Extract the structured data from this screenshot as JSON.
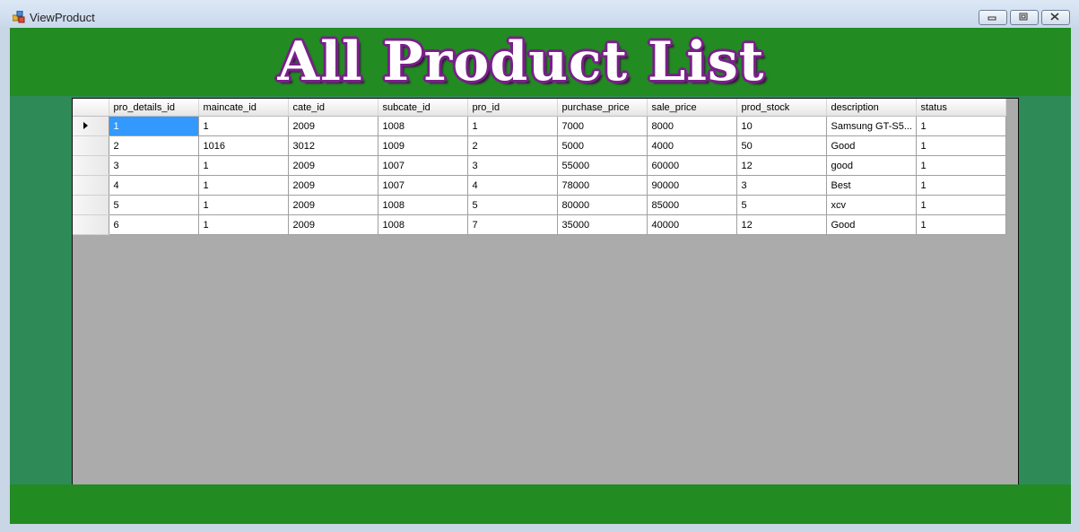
{
  "window": {
    "title": "ViewProduct"
  },
  "header": {
    "title": "All Product List"
  },
  "grid": {
    "columns": [
      "pro_details_id",
      "maincate_id",
      "cate_id",
      "subcate_id",
      "pro_id",
      "purchase_price",
      "sale_price",
      "prod_stock",
      "description",
      "status"
    ],
    "rows": [
      [
        "1",
        "1",
        "2009",
        "1008",
        "1",
        "7000",
        "8000",
        "10",
        "Samsung GT-S5...",
        "1"
      ],
      [
        "2",
        "1016",
        "3012",
        "1009",
        "2",
        "5000",
        "4000",
        "50",
        "Good",
        "1"
      ],
      [
        "3",
        "1",
        "2009",
        "1007",
        "3",
        "55000",
        "60000",
        "12",
        "good",
        "1"
      ],
      [
        "4",
        "1",
        "2009",
        "1007",
        "4",
        "78000",
        "90000",
        "3",
        "Best",
        "1"
      ],
      [
        "5",
        "1",
        "2009",
        "1008",
        "5",
        "80000",
        "85000",
        "5",
        "xcv",
        "1"
      ],
      [
        "6",
        "1",
        "2009",
        "1008",
        "7",
        "35000",
        "40000",
        "12",
        "Good",
        "1"
      ]
    ]
  },
  "colors": {
    "client_bg": "#2e8b57",
    "header_band": "#228b22",
    "title_outline": "#7a1f8a",
    "grid_bg": "#ababab",
    "selection": "#3399ff"
  }
}
